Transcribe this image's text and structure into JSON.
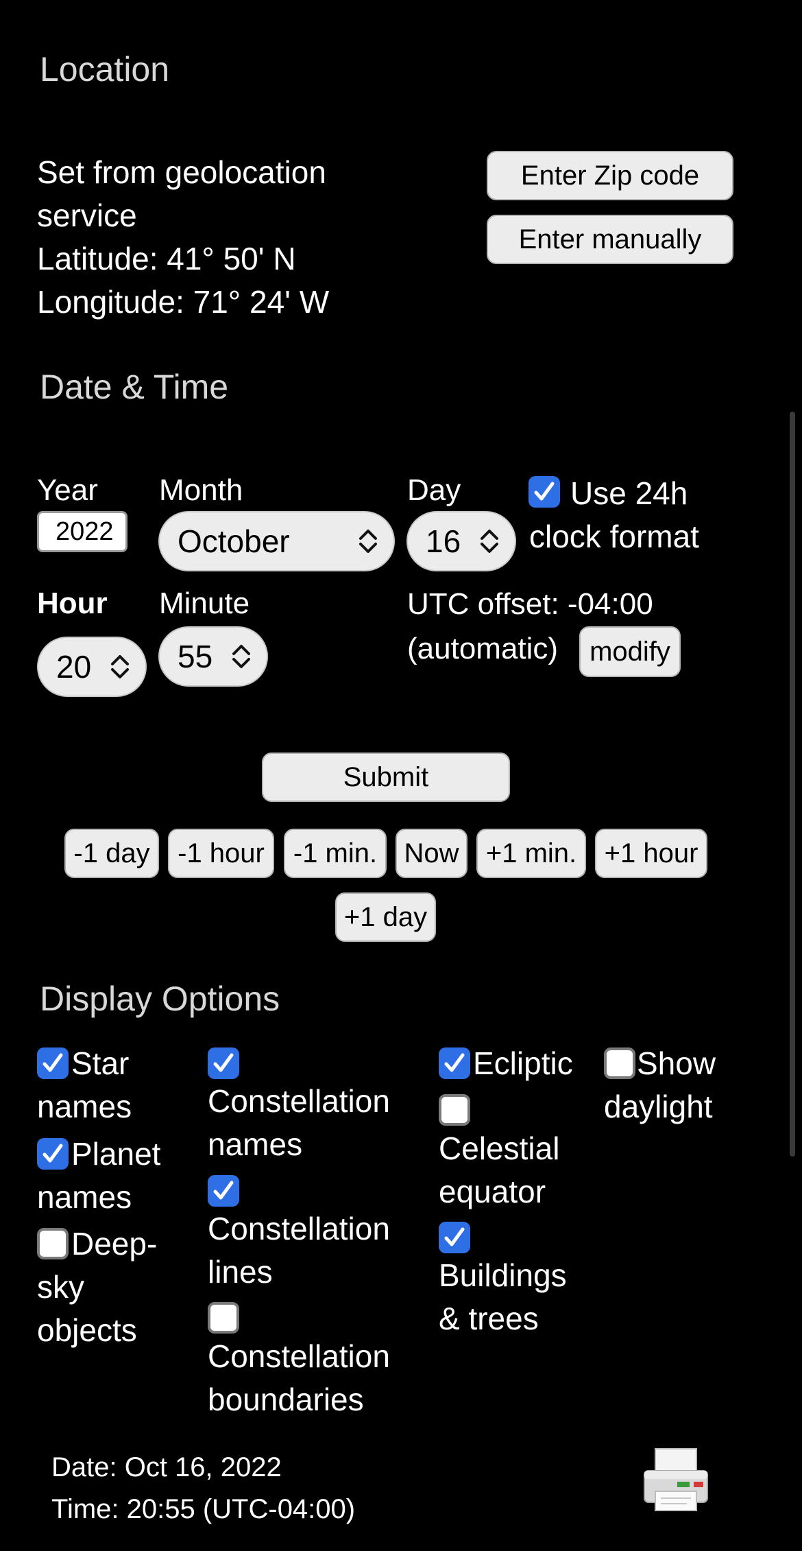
{
  "location": {
    "title": "Location",
    "source_line1": "Set from geolocation",
    "source_line2": "service",
    "latitude": "Latitude: 41° 50' N",
    "longitude": "Longitude: 71° 24' W",
    "zip_button": "Enter Zip code",
    "manual_button": "Enter manually"
  },
  "datetime": {
    "title": "Date & Time",
    "year_label": "Year",
    "year_value": "2022",
    "month_label": "Month",
    "month_value": "October",
    "day_label": "Day",
    "day_value": "16",
    "clock24_checked": true,
    "clock24_line1": "Use 24h",
    "clock24_line2": "clock format",
    "hour_label": "Hour",
    "hour_value": "20",
    "minute_label": "Minute",
    "minute_value": "55",
    "utc_line1": "UTC offset: -04:00",
    "utc_line2": "(automatic)",
    "modify_button": "modify",
    "submit_button": "Submit",
    "step_buttons": [
      "-1 day",
      "-1 hour",
      "-1 min.",
      "Now",
      "+1 min.",
      "+1 hour",
      "+1 day"
    ]
  },
  "display": {
    "title": "Display Options",
    "options": [
      {
        "lines": [
          "Star",
          "names"
        ],
        "checked": true
      },
      {
        "lines": [
          "Planet",
          "names"
        ],
        "checked": true
      },
      {
        "lines": [
          "Deep-",
          "sky",
          "objects"
        ],
        "checked": false
      },
      {
        "lines": [
          "Constellation",
          "names"
        ],
        "checked": true
      },
      {
        "lines": [
          "Constellation",
          "lines"
        ],
        "checked": true
      },
      {
        "lines": [
          "Constellation",
          "boundaries"
        ],
        "checked": false
      },
      {
        "lines": [
          "Ecliptic"
        ],
        "checked": true
      },
      {
        "lines": [
          "Celestial",
          "equator"
        ],
        "checked": false
      },
      {
        "lines": [
          "Buildings",
          "& trees"
        ],
        "checked": true
      },
      {
        "lines": [
          "Show",
          "daylight"
        ],
        "checked": false
      }
    ]
  },
  "footer": {
    "date": "Date: Oct 16, 2022",
    "time": "Time: 20:55 (UTC-04:00)"
  },
  "colors": {
    "background": "#000000",
    "checkbox_checked": "#2f6fe6",
    "button_face": "#ececec"
  },
  "icons": {
    "select": "chevron-up-down-icon",
    "check": "checkmark-icon",
    "print": "printer-icon"
  }
}
